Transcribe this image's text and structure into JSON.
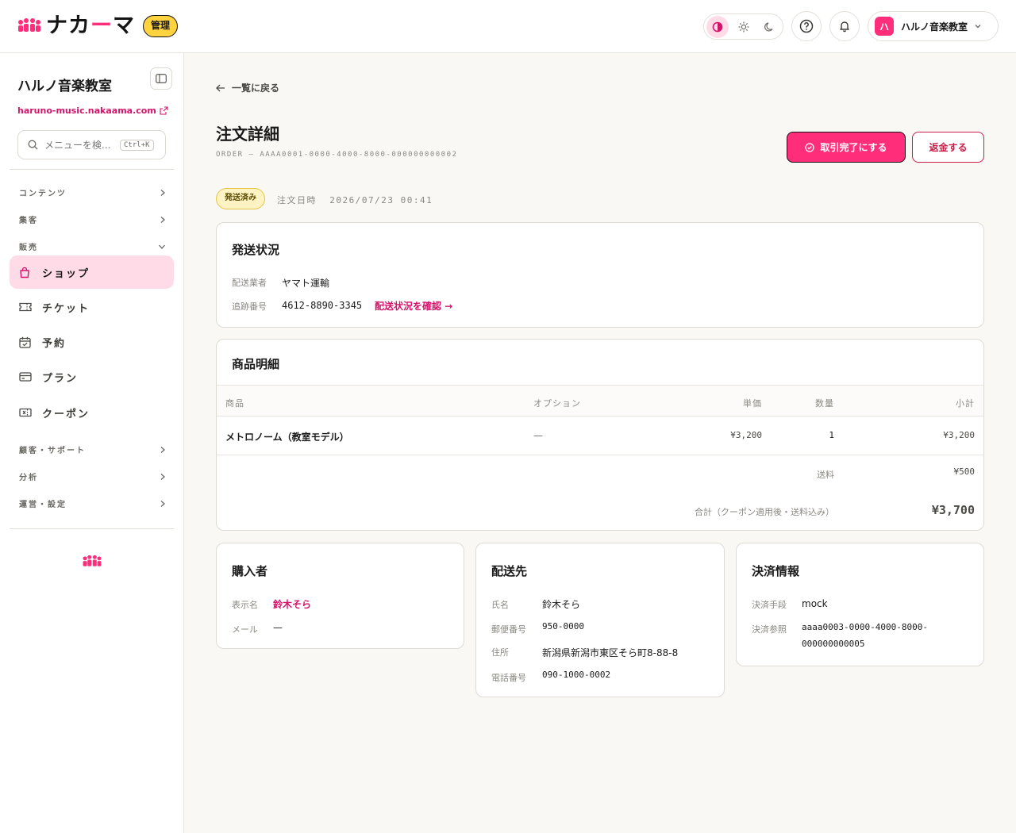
{
  "brand": {
    "name_prefix": "ナカ",
    "name_dash": "ー",
    "name_suffix": "マ",
    "admin_badge": "管理",
    "accent": "#ff2d7a"
  },
  "account": {
    "avatar_letter": "ハ",
    "name": "ハルノ音楽教室"
  },
  "sidebar": {
    "school_name": "ハルノ音楽教室",
    "site_url": "haruno-music.nakaama.com",
    "search_placeholder": "メニューを検...",
    "search_shortcut": "Ctrl+K",
    "sections": [
      {
        "label": "コンテンツ"
      },
      {
        "label": "集客"
      },
      {
        "label": "販売"
      },
      {
        "label": "顧客・サポート"
      },
      {
        "label": "分析"
      },
      {
        "label": "運営・設定"
      }
    ],
    "items": [
      {
        "label": "ショップ",
        "icon": "shopping-bag-icon",
        "active": true
      },
      {
        "label": "チケット",
        "icon": "ticket-icon"
      },
      {
        "label": "予約",
        "icon": "calendar-icon"
      },
      {
        "label": "プラン",
        "icon": "card-icon"
      },
      {
        "label": "クーポン",
        "icon": "coupon-icon"
      }
    ]
  },
  "page": {
    "back_label": "一覧に戻る",
    "title": "注文詳細",
    "order_id": "ORDER — AAAA0001-0000-4000-8000-000000000002",
    "complete_button": "取引完了にする",
    "refund_button": "返金する",
    "status": "発送済み",
    "order_date_label": "注文日時",
    "order_date": "2026/07/23 00:41"
  },
  "shipping_status": {
    "title": "発送状況",
    "carrier_label": "配送業者",
    "carrier": "ヤマト運輸",
    "tracking_label": "追跡番号",
    "tracking": "4612-8890-3345",
    "tracking_link": "配送状況を確認 →"
  },
  "items": {
    "title": "商品明細",
    "headers": {
      "product": "商品",
      "option": "オプション",
      "price": "単価",
      "qty": "数量",
      "subtotal": "小計"
    },
    "rows": [
      {
        "product": "メトロノーム（教室モデル）",
        "option": "—",
        "price": "¥3,200",
        "qty": "1",
        "subtotal": "¥3,200"
      }
    ],
    "shipping_label": "送料",
    "shipping": "¥500",
    "total_label": "合計（クーポン適用後・送料込み）",
    "total": "¥3,700"
  },
  "buyer": {
    "title": "購入者",
    "name_label": "表示名",
    "name": "鈴木そら",
    "email_label": "メール",
    "email": "—"
  },
  "destination": {
    "title": "配送先",
    "name_label": "氏名",
    "name": "鈴木そら",
    "zip_label": "郵便番号",
    "zip": "950-0000",
    "address_label": "住所",
    "address": "新潟県新潟市東区そら町8-88-8",
    "phone_label": "電話番号",
    "phone": "090-1000-0002"
  },
  "payment": {
    "title": "決済情報",
    "method_label": "決済手段",
    "method": "mock",
    "ref_label": "決済参照",
    "ref_line1": "aaaa0003-0000-4000-8000-",
    "ref_line2": "000000000005"
  }
}
